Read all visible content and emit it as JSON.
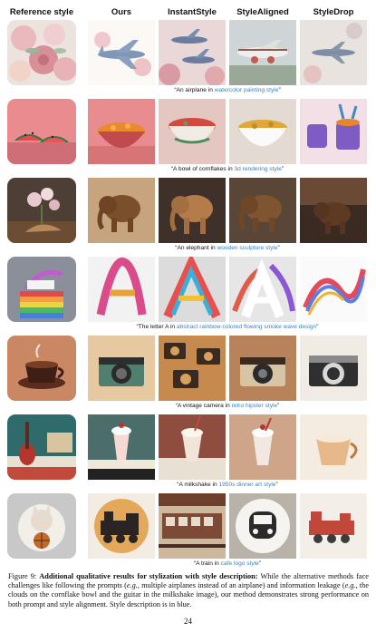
{
  "headers": {
    "reference": "Reference style",
    "ours": "Ours",
    "instantstyle": "InstantStyle",
    "stylealigned": "StyleAligned",
    "styledrop": "StyleDrop"
  },
  "rows": [
    {
      "prefix": "“An airplane in ",
      "style": "watercolor painting style",
      "suffix": "”"
    },
    {
      "prefix": "“A bowl of cornflakes in ",
      "style": "3d rendering style",
      "suffix": "”"
    },
    {
      "prefix": "“An elephant in ",
      "style": "wooden sculpture style",
      "suffix": "”"
    },
    {
      "prefix": "“The letter A in ",
      "style": "abstract rainbow-colored flowing smoke wave design",
      "suffix": "”"
    },
    {
      "prefix": "“A vintage camera in ",
      "style": "retro hipster style",
      "suffix": "”"
    },
    {
      "prefix": "“A milkshake in ",
      "style": "1950s dinner art style",
      "suffix": "”"
    },
    {
      "prefix": "“A train in ",
      "style": "cafe logo style",
      "suffix": "”"
    }
  ],
  "figure_caption": {
    "label": "Figure 9:",
    "bold_title": "Additional qualitative results for stylization with style description:",
    "body_1": " While the alternative methods face challenges like following the prompts (",
    "eg1": "e.g.",
    "body_2": ", multiple airplanes instead of an airplane) and information leakage (",
    "eg2": "e.g.",
    "body_3": ", the clouds on the cornflake bowl and the guitar in the milkshake image), our method demonstrates strong performance on both prompt and style alignment. Style description is in blue."
  },
  "page_number": "24",
  "colors": {
    "style_text": "#3b82c4"
  }
}
